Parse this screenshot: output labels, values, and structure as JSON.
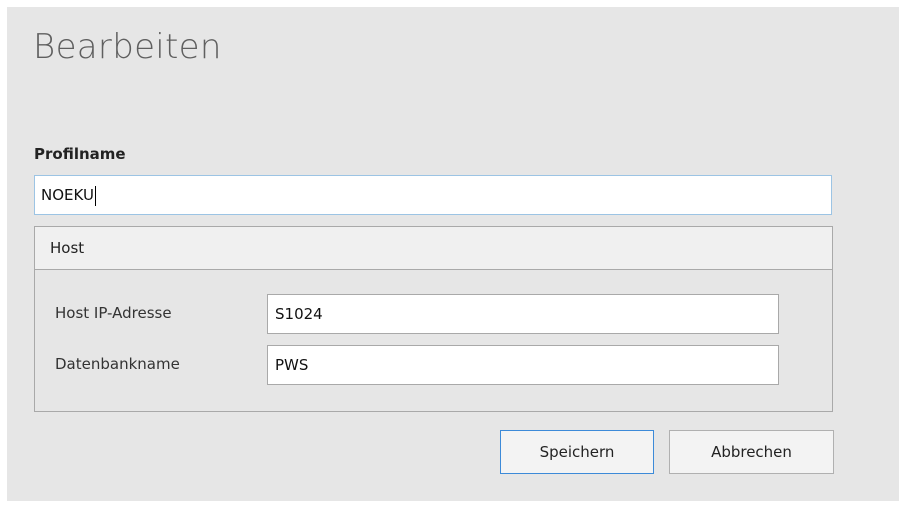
{
  "dialog": {
    "title": "Bearbeiten"
  },
  "profile": {
    "label": "Profilname",
    "value": "NOEKU"
  },
  "host_group": {
    "header": "Host",
    "ip_label": "Host IP-Adresse",
    "ip_value": "S1024",
    "db_label": "Datenbankname",
    "db_value": "PWS"
  },
  "buttons": {
    "save": "Speichern",
    "cancel": "Abbrechen"
  },
  "colors": {
    "focus_border": "#9cc4e4",
    "primary_button_border": "#3c8ad8",
    "dialog_background": "#e6e6e6"
  }
}
